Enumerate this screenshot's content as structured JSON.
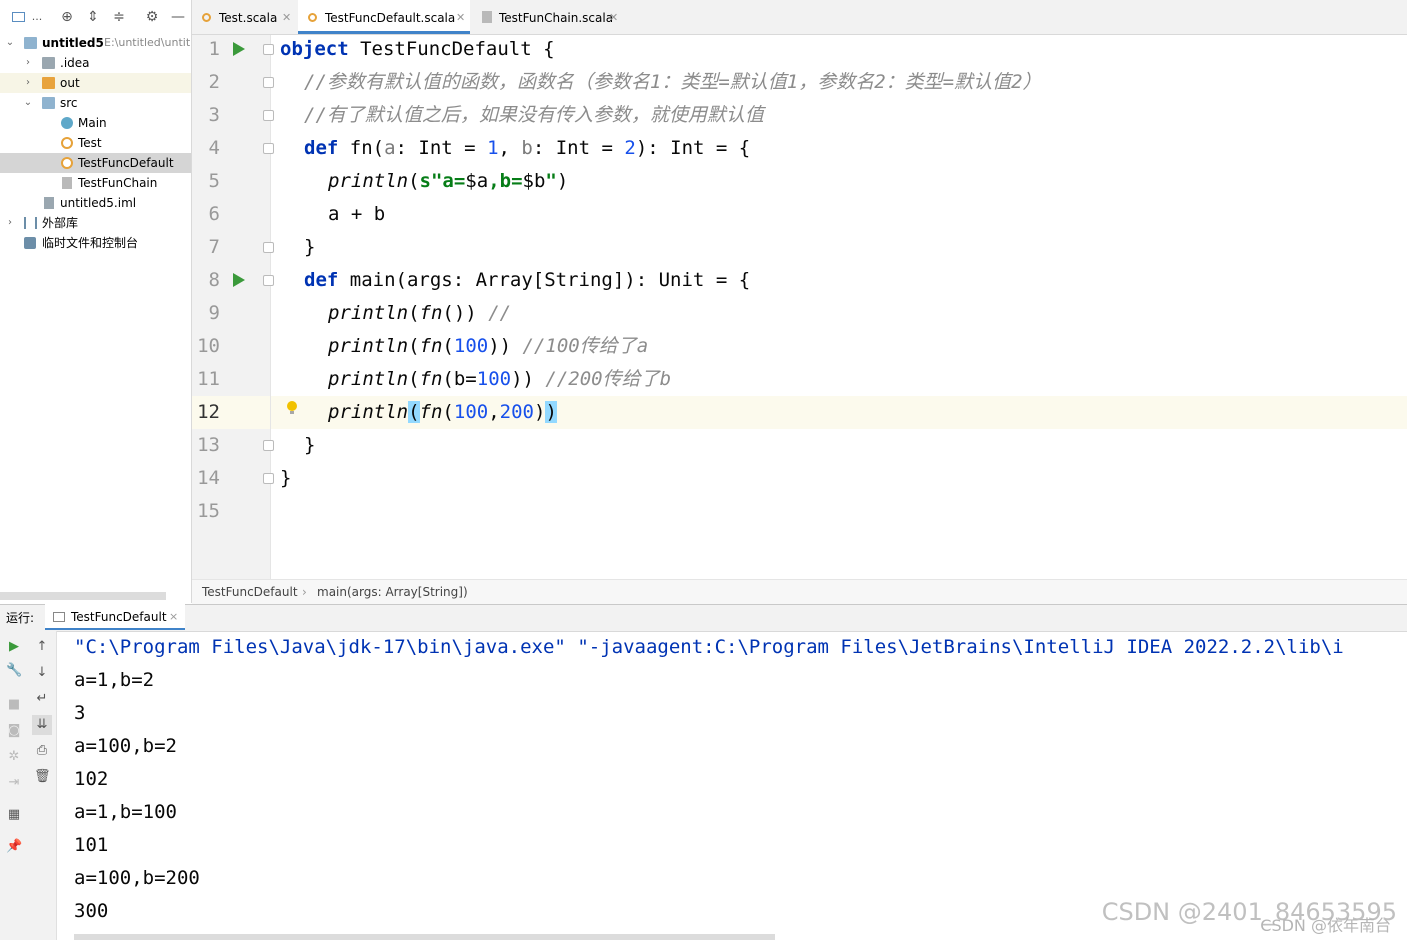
{
  "project_toolbar": {
    "dots_label": "...",
    "icons": [
      "window-icon",
      "locate-icon",
      "expand-all-icon",
      "collapse-all-icon",
      "settings-icon",
      "hide-icon"
    ]
  },
  "tree": [
    {
      "label": "untitled5",
      "hint": "E:\\untitled\\untit",
      "icon": "module-folder"
    },
    {
      "label": ".idea",
      "icon": "folder"
    },
    {
      "label": "out",
      "icon": "folder-orange"
    },
    {
      "label": "src",
      "icon": "folder"
    },
    {
      "label": "Main",
      "icon": "scala-class"
    },
    {
      "label": "Test",
      "icon": "scala-object"
    },
    {
      "label": "TestFuncDefault",
      "icon": "scala-object"
    },
    {
      "label": "TestFunChain",
      "icon": "scala-file"
    },
    {
      "label": "untitled5.iml",
      "icon": "iml-file"
    },
    {
      "label": "外部库",
      "icon": "library"
    },
    {
      "label": "临时文件和控制台",
      "icon": "scratches"
    }
  ],
  "tabs": [
    {
      "label": "Test.scala"
    },
    {
      "label": "TestFuncDefault.scala"
    },
    {
      "label": "TestFunChain.scala"
    }
  ],
  "line_numbers": [
    "1",
    "2",
    "3",
    "4",
    "5",
    "6",
    "7",
    "8",
    "9",
    "10",
    "11",
    "12",
    "13",
    "14",
    "15"
  ],
  "code": {
    "l1": {
      "kw": "object",
      "rest": " TestFuncDefault {"
    },
    "l2": "//参数有默认值的函数，函数名（参数名1：类型=默认值1，参数名2：类型=默认值2）",
    "l3": "//有了默认值之后，如果没有传入参数，就使用默认值",
    "l4": {
      "kw": "def",
      "a": " fn(",
      "p1": "a",
      "b": ": Int = ",
      "n1": "1",
      "c": ", ",
      "p2": "b",
      "d": ": Int = ",
      "n2": "2",
      "e": "): Int = {"
    },
    "l5": {
      "fn": "println",
      "a": "(",
      "s1": "s\"a=",
      "v1": "$a",
      "s2": ",b=",
      "v2": "$b",
      "s3": "\"",
      "b": ")"
    },
    "l6": "a + b",
    "l7": "}",
    "l8": {
      "kw": "def",
      "rest": " main(args: Array[String]): Unit = {"
    },
    "l9": {
      "fn": "println",
      "a": "(",
      "fn2": "fn",
      "b": "()) ",
      "cmt": "//"
    },
    "l10": {
      "fn": "println",
      "a": "(",
      "fn2": "fn",
      "b": "(",
      "n": "100",
      "c": ")) ",
      "cmt": "//100传给了a"
    },
    "l11": {
      "fn": "println",
      "a": "(",
      "fn2": "fn",
      "b": "(b=",
      "n": "100",
      "c": ")) ",
      "cmt": "//200传给了b"
    },
    "l12": {
      "fn": "println",
      "a": "(",
      "fn2": "fn",
      "b": "(",
      "n1": "100",
      "c": ",",
      "n2": "200",
      "d": ")",
      "e": ")"
    },
    "l13": "}",
    "l14": "}"
  },
  "breadcrumb": {
    "item1": "TestFuncDefault",
    "sep": "›",
    "item2": "main(args: Array[String])"
  },
  "run_panel": {
    "label": "运行:",
    "tab": "TestFuncDefault",
    "close": "×"
  },
  "console": [
    "\"C:\\Program Files\\Java\\jdk-17\\bin\\java.exe\" \"-javaagent:C:\\Program Files\\JetBrains\\IntelliJ IDEA 2022.2.2\\lib\\i",
    "a=1,b=2",
    "3",
    "a=100,b=2",
    "102",
    "a=1,b=100",
    "101",
    "a=100,b=200",
    "300"
  ],
  "watermark": "CSDN @2401_84653595",
  "watermark2": "CSDN @依年南台",
  "colors": {
    "keyword": "#0033b3",
    "comment": "#8c8c8c",
    "number": "#1750eb",
    "string": "#067d17",
    "accent": "#4083c9",
    "run_green": "#3b9a3b"
  }
}
